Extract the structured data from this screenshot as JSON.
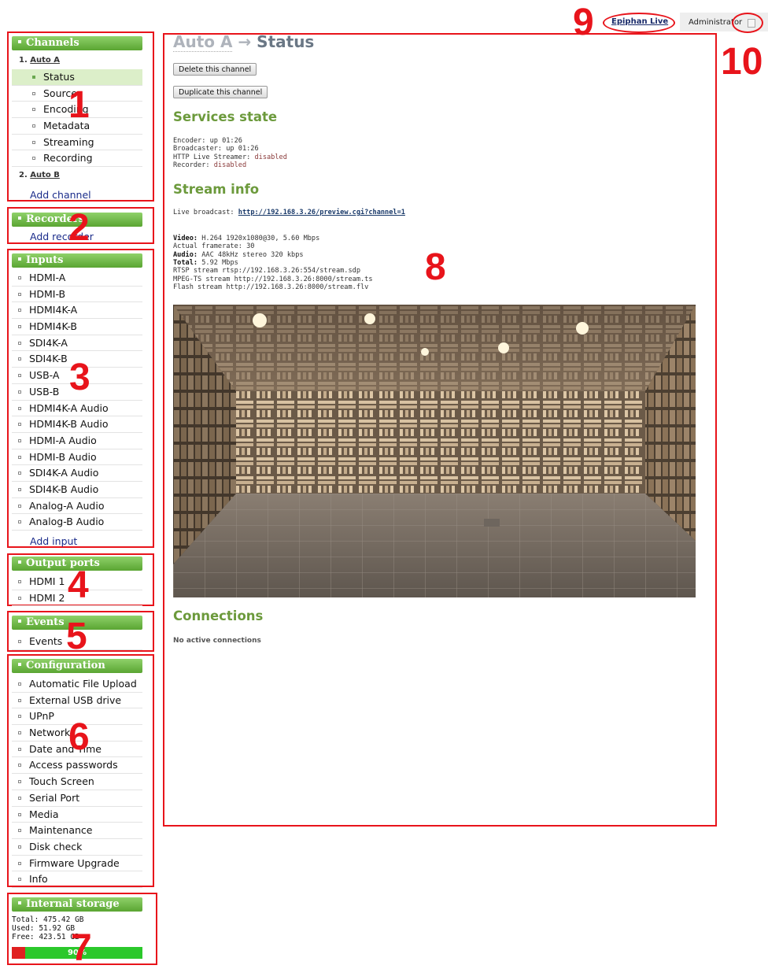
{
  "header": {
    "brand_link": "Epiphan Live",
    "user": "Administrator",
    "logout_icon": "logout-icon"
  },
  "sidebar": {
    "channels": {
      "title": "Channels",
      "channel1": {
        "num": "1.",
        "name": "Auto A"
      },
      "items": [
        "Status",
        "Sources",
        "Encoding",
        "Metadata",
        "Streaming",
        "Recording"
      ],
      "active": "Status",
      "channel2": {
        "num": "2.",
        "name": "Auto B"
      },
      "add": "Add channel"
    },
    "recorders": {
      "title": "Recorders",
      "add": "Add recorder"
    },
    "inputs": {
      "title": "Inputs",
      "items": [
        "HDMI-A",
        "HDMI-B",
        "HDMI4K-A",
        "HDMI4K-B",
        "SDI4K-A",
        "SDI4K-B",
        "USB-A",
        "USB-B",
        "HDMI4K-A Audio",
        "HDMI4K-B Audio",
        "HDMI-A Audio",
        "HDMI-B Audio",
        "SDI4K-A Audio",
        "SDI4K-B Audio",
        "Analog-A Audio",
        "Analog-B Audio"
      ],
      "add": "Add input"
    },
    "output_ports": {
      "title": "Output ports",
      "items": [
        "HDMI 1",
        "HDMI 2"
      ]
    },
    "events": {
      "title": "Events",
      "items": [
        "Events"
      ]
    },
    "configuration": {
      "title": "Configuration",
      "items": [
        "Automatic File Upload",
        "External USB drive",
        "UPnP",
        "Network",
        "Date and Time",
        "Access passwords",
        "Touch Screen",
        "Serial Port",
        "Media",
        "Maintenance",
        "Disk check",
        "Firmware Upgrade",
        "Info"
      ]
    },
    "storage": {
      "title": "Internal storage",
      "total": "Total: 475.42 GB",
      "used": "Used: 51.92 GB",
      "free": "Free: 423.51 GB",
      "free_percent_label": "90%",
      "free_fraction": 0.9
    }
  },
  "main": {
    "title_channel": "Auto A",
    "title_arrow": "→",
    "title_page": "Status",
    "delete_button": "Delete this channel",
    "duplicate_button": "Duplicate this channel",
    "services_heading": "Services state",
    "services": {
      "encoder": "Encoder: up 01:26",
      "broadcaster": "Broadcaster: up 01:26",
      "hls_label": "HTTP Live Streamer: ",
      "hls_value": "disabled",
      "recorder_label": "Recorder: ",
      "recorder_value": "disabled"
    },
    "stream_heading": "Stream info",
    "live_broadcast_label": "Live broadcast: ",
    "live_broadcast_url": "http://192.168.3.26/preview.cgi?channel=1",
    "video_label": "Video:",
    "video_value": " H.264 1920x1080@30, 5.60 Mbps",
    "framerate": "Actual framerate: 30",
    "audio_label": "Audio:",
    "audio_value": " AAC 48kHz stereo 320 kbps",
    "total_label": "Total:",
    "total_value": " 5.92 Mbps",
    "rtsp": "RTSP stream rtsp://192.168.3.26:554/stream.sdp",
    "mpegts": "MPEG-TS stream http://192.168.3.26:8000/stream.ts",
    "flash": "Flash stream http://192.168.3.26:8000/stream.flv",
    "connections_heading": "Connections",
    "no_connections": "No active connections"
  },
  "annotations": [
    "1",
    "2",
    "3",
    "4",
    "5",
    "6",
    "7",
    "8",
    "9",
    "10"
  ],
  "colors": {
    "annotation_red": "#e8141b",
    "panel_green": "#6aa84f",
    "heading_green": "#6c9a3c"
  }
}
